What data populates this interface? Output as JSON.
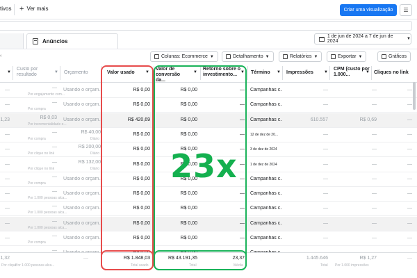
{
  "topbar": {
    "partial_label": "tivos",
    "ver_mais": "Ver mais",
    "create_view": "Criar uma visualização"
  },
  "tabs": {
    "anuncios": "Anúncios",
    "date_range": "1 de jun de 2024 a 7 de jun de 2024"
  },
  "toolbar": {
    "colunas": "Colunas: Ecommerce",
    "detalhamento": "Detalhamento",
    "relatorios": "Relatórios",
    "exportar": "Exportar",
    "graficos": "Gráficos"
  },
  "columns": {
    "custo": "Custo por resultado",
    "orcamento": "Orçamento",
    "valor_usado": "Valor usado",
    "valor_conversao": "Valor de conversão da...",
    "retorno": "Retorno sobre o investimento...",
    "termino": "Término",
    "impressoes": "Impressões",
    "cpm": "CPM (custo por 1.000...",
    "cliques": "Cliques no link"
  },
  "rows": [
    {
      "left": "—",
      "custo": "—",
      "custo_sub": "Por engajamento com...",
      "orc": "Usando o orçam...",
      "valor": "R$ 0,00",
      "conv": "R$ 0,00",
      "ret": "—",
      "term": "Campanhas c...",
      "imp": "—",
      "cpm": "—",
      "cli": "—",
      "shaded": false
    },
    {
      "left": "—",
      "custo": "—",
      "custo_sub": "Por compra",
      "orc": "Usando o orçam...",
      "valor": "R$ 0,00",
      "conv": "R$ 0,00",
      "ret": "—",
      "term": "Campanhas c...",
      "imp": "—",
      "cpm": "—",
      "cli": "—",
      "shaded": false
    },
    {
      "left": "1,23",
      "custo": "R$ 0,03",
      "custo_sub": "Por incrementalidade e...",
      "orc": "Usando o orçam...",
      "valor": "R$ 420,69",
      "conv": "R$ 0,00",
      "ret": "—",
      "term": "Campanhas c...",
      "imp": "610.557",
      "cpm": "R$ 0,69",
      "cli": "—",
      "shaded": true
    },
    {
      "left": "—",
      "custo": "—",
      "custo_sub": "Por compra",
      "orc": "R$ 40,00",
      "orc_sub": "Diário",
      "valor": "R$ 0,00",
      "conv": "R$ 0,00",
      "ret": "—",
      "term": "12 de dez de 20...",
      "imp": "—",
      "cpm": "—",
      "cli": "—",
      "shaded": false
    },
    {
      "left": "—",
      "custo": "—",
      "custo_sub": "Por clique no link",
      "orc": "R$ 200,00",
      "orc_sub": "Diário",
      "valor": "R$ 0,00",
      "conv": "R$ 0,00",
      "ret": "—",
      "term": "3 de dez de 2024",
      "imp": "—",
      "cpm": "—",
      "cli": "—",
      "shaded": false
    },
    {
      "left": "—",
      "custo": "—",
      "custo_sub": "Por clique no link",
      "orc": "R$ 132,00",
      "orc_sub": "Diário",
      "valor": "R$ 0,00",
      "conv": "R$ 0,00",
      "ret": "—",
      "term": "1 de dez de 2024",
      "imp": "—",
      "cpm": "—",
      "cli": "—",
      "shaded": false
    },
    {
      "left": "—",
      "custo": "—",
      "custo_sub": "Por compra",
      "orc": "Usando o orçam...",
      "valor": "R$ 0,00",
      "conv": "R$ 0,00",
      "ret": "—",
      "term": "Campanhas c...",
      "imp": "—",
      "cpm": "—",
      "cli": "—",
      "shaded": false
    },
    {
      "left": "—",
      "custo": "—",
      "custo_sub": "Por 1.000 pessoas alca...",
      "orc": "Usando o orçam...",
      "valor": "R$ 0,00",
      "conv": "R$ 0,00",
      "ret": "—",
      "term": "Campanhas c...",
      "imp": "—",
      "cpm": "—",
      "cli": "—",
      "shaded": false
    },
    {
      "left": "—",
      "custo": "—",
      "custo_sub": "Por 1.000 pessoas alca...",
      "orc": "Usando o orçam...",
      "valor": "R$ 0,00",
      "conv": "R$ 0,00",
      "ret": "—",
      "term": "Campanhas c...",
      "imp": "—",
      "cpm": "—",
      "cli": "—",
      "shaded": false
    },
    {
      "left": "—",
      "custo": "—",
      "custo_sub": "Por 1.000 pessoas alca...",
      "orc": "Usando o orçam...",
      "valor": "R$ 0,00",
      "conv": "R$ 0,00",
      "ret": "—",
      "term": "Campanhas c...",
      "imp": "—",
      "cpm": "—",
      "cli": "—",
      "shaded": true
    },
    {
      "left": "—",
      "custo": "—",
      "custo_sub": "Por compra",
      "orc": "Usando o orçam...",
      "valor": "R$ 0,00",
      "conv": "R$ 0,00",
      "ret": "—",
      "term": "Campanhas c...",
      "imp": "—",
      "cpm": "—",
      "cli": "—",
      "shaded": false
    },
    {
      "left": "—",
      "custo": "—",
      "custo_sub": "Por compra",
      "orc": "Usando o orçam...",
      "valor": "R$ 0,00",
      "conv": "R$ 0,00",
      "ret": "—",
      "term": "Campanhas c...",
      "imp": "—",
      "cpm": "—",
      "cli": "—",
      "shaded": false
    }
  ],
  "totals": {
    "left": "1,32",
    "left_sub": "Por clique",
    "custo_sub": "Por 1.000 pessoas alca...",
    "orc": "—",
    "valor": "R$ 1.848,03",
    "valor_sub": "Total usado",
    "conv": "R$ 43.191,35",
    "conv_sub": "Total",
    "ret": "23,37",
    "ret_sub": "Média",
    "imp": "1.445.646",
    "imp_sub": "Total",
    "cpm": "R$ 1,27",
    "cpm_sub": "Por 1.000 impressões",
    "cli": "—"
  },
  "annotation": {
    "big_text": "23x",
    "red_color": "#e74c4c",
    "green_color": "#1ab35a"
  }
}
